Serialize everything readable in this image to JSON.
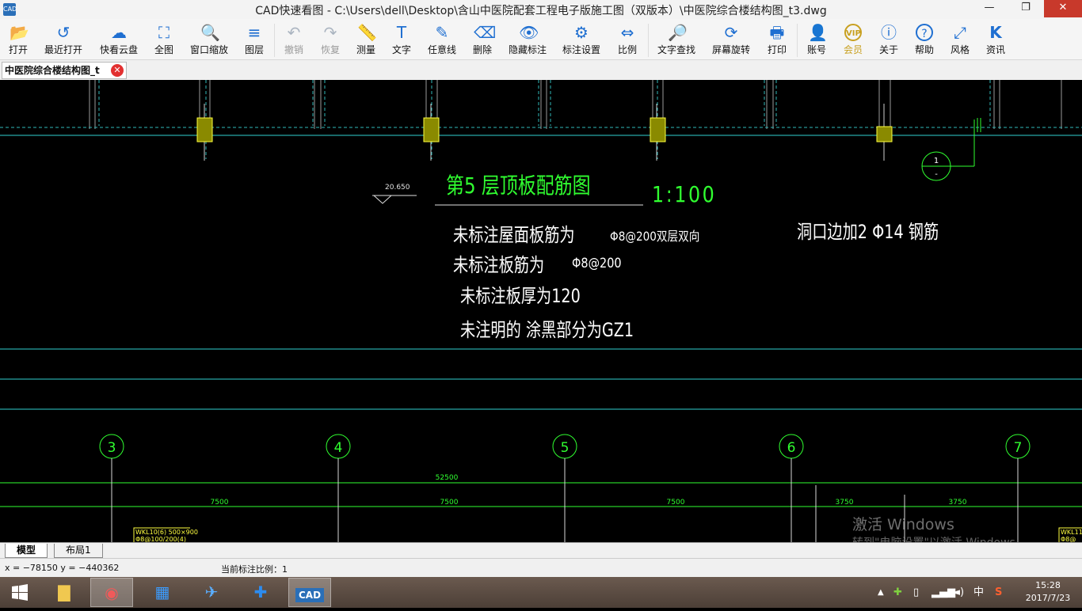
{
  "window": {
    "icon_text": "CAD",
    "title": "CAD快速看图 - C:\\Users\\dell\\Desktop\\含山中医院配套工程电子版施工图（双版本）\\中医院综合楼结构图_t3.dwg",
    "min": "—",
    "restore": "❐",
    "close": "✕"
  },
  "toolbar": {
    "open": "打开",
    "recent": "最近打开",
    "cloud": "快看云盘",
    "fullview": "全图",
    "window_zoom": "窗口缩放",
    "layers": "图层",
    "undo": "撤销",
    "redo": "恢复",
    "measure": "测量",
    "text": "文字",
    "freeline": "任意线",
    "delete": "删除",
    "hide_marks": "隐藏标注",
    "mark_settings": "标注设置",
    "scale": "比例",
    "text_search": "文字查找",
    "rotate": "屏幕旋转",
    "print": "打印",
    "account": "账号",
    "vip": "会员",
    "about": "关于",
    "help": "帮助",
    "style": "风格",
    "news": "资讯"
  },
  "icons": {
    "open": "📂",
    "recent": "↺",
    "cloud": "☁",
    "fullview": "⛶",
    "window_zoom": "🔍",
    "layers": "≡",
    "undo": "↶",
    "redo": "↷",
    "measure": "📏",
    "text": "T",
    "freeline": "✎",
    "delete": "⌫",
    "hide_marks": "👁",
    "mark_settings": "⚙",
    "scale": "⇔",
    "text_search": "🔎",
    "rotate": "⟳",
    "print": "🖶",
    "account": "👤",
    "vip": "VIP",
    "about": "ⓘ",
    "help": "?",
    "style": "⤢",
    "news": "K"
  },
  "doc_tab": {
    "label": "中医院综合楼结构图_t",
    "close": "✕"
  },
  "drawing": {
    "title": "第5 层顶板配筋图",
    "scale": "1:100",
    "elevation": "20.650",
    "note1": "未标注屋面板筋为",
    "note1_value": "Φ8@200双层双向",
    "note2": "未标注板筋为",
    "note2_value": "Φ8@200",
    "note3": "未标注板厚为120",
    "note4": "未注明的 涂黑部分为GZ1",
    "opening_note": "洞口边加2 Φ14 钢筋",
    "section_top": "1",
    "section_bottom": "-",
    "axes": [
      "3",
      "4",
      "5",
      "6",
      "7"
    ],
    "total_dim": "52500",
    "span_dims": [
      "7500",
      "7500",
      "7500",
      "3750",
      "3750"
    ],
    "beam_label_1": "WKL10(6) 500×900",
    "beam_label_1b": "Φ8@100/200(4)",
    "beam_label_2": "WKL11(",
    "beam_label_2b": "Φ8@"
  },
  "layout_tabs": {
    "model": "模型",
    "layout1": "布局1"
  },
  "status": {
    "coords": "x = −78150  y = −440362",
    "scale_label": "当前标注比例：1"
  },
  "watermark": {
    "line1": "激活 Windows",
    "line2": "转到\"电脑设置\"以激活 Windows。"
  },
  "taskbar": {
    "ime": "中",
    "time": "15:28",
    "date": "2017/7/23"
  }
}
